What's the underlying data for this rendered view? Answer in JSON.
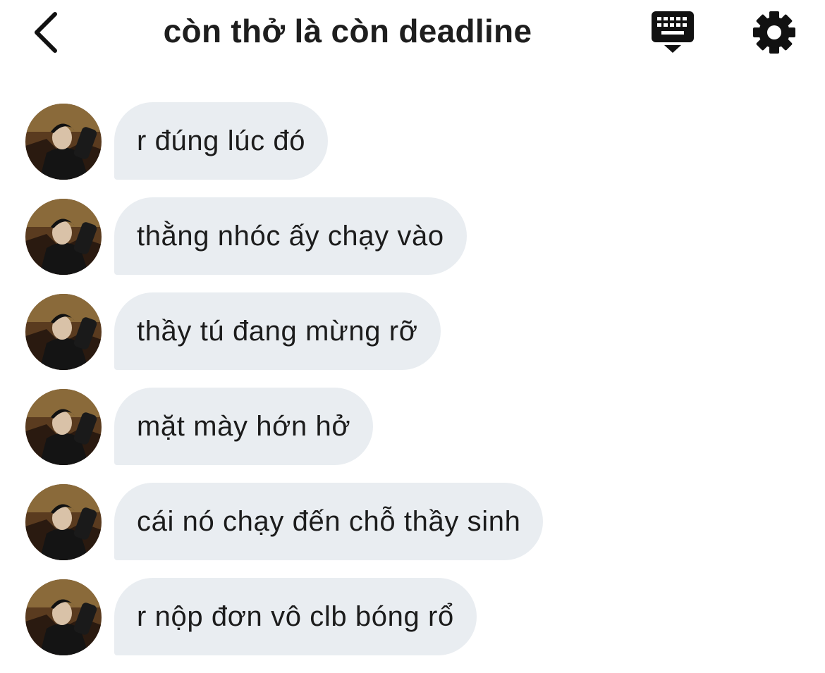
{
  "header": {
    "title": "còn thở là còn deadline",
    "back_icon": "chevron-left-icon",
    "keyboard_icon": "keyboard-icon",
    "settings_icon": "gear-icon"
  },
  "avatar": {
    "description_icon": "user-avatar-photo"
  },
  "messages": [
    {
      "text": "r đúng lúc đó"
    },
    {
      "text": "thằng nhóc ấy chạy vào"
    },
    {
      "text": "thầy tú đang mừng rỡ"
    },
    {
      "text": "mặt mày hớn hở"
    },
    {
      "text": "cái nó chạy đến chỗ thầy sinh"
    },
    {
      "text": "r nộp đơn vô clb bóng rổ"
    }
  ],
  "colors": {
    "bubble": "#e9edf1",
    "text": "#1c1c1c",
    "icon": "#111111"
  }
}
